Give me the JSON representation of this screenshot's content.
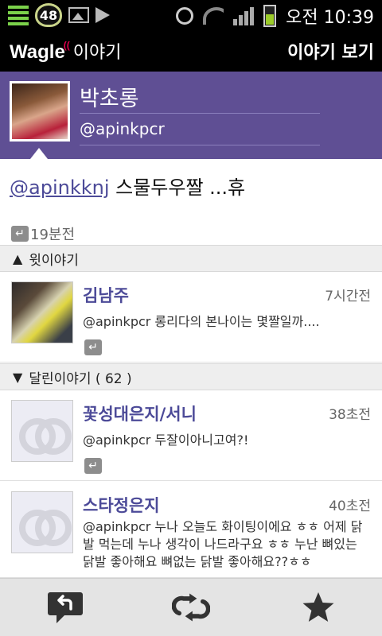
{
  "status_bar": {
    "badge": "48",
    "time": "오전 10:39"
  },
  "app_bar": {
    "logo_brand": "Wagle",
    "logo_sub": "이야기",
    "title": "이야기 보기"
  },
  "profile": {
    "name": "박초롱",
    "handle": "@apinkpcr"
  },
  "tweet": {
    "mention": "@apinkknj",
    "text": " 스물두우짤 ...휴",
    "time": "19분전"
  },
  "sections": {
    "above": "윗이야기",
    "replies": "달린이야기 ( 62 )"
  },
  "above_item": {
    "name": "김남주",
    "time": "7시간전",
    "text": "@apinkpcr  롱리다의 본나이는 몇짤일까...."
  },
  "reply_items": [
    {
      "name": "꽃성대은지/서니",
      "time": "38초전",
      "text": "@apinkpcr 두잘이아니고여?!"
    },
    {
      "name": "스타정은지",
      "time": "40초전",
      "text": "@apinkpcr 누나 오늘도 화이팅이에요 ㅎㅎ 어제 닭발 먹는데 누나 생각이 나드라구요 ㅎㅎ 누난 뼈있는 닭발 좋아해요 뼈없는 닭발 좋아해요??ㅎㅎ"
    }
  ],
  "icons": {
    "reply": "reply-icon",
    "retweet": "retweet-icon",
    "favorite": "star-icon"
  },
  "colors": {
    "accent": "#5f4f94",
    "link": "#4c4a98"
  }
}
